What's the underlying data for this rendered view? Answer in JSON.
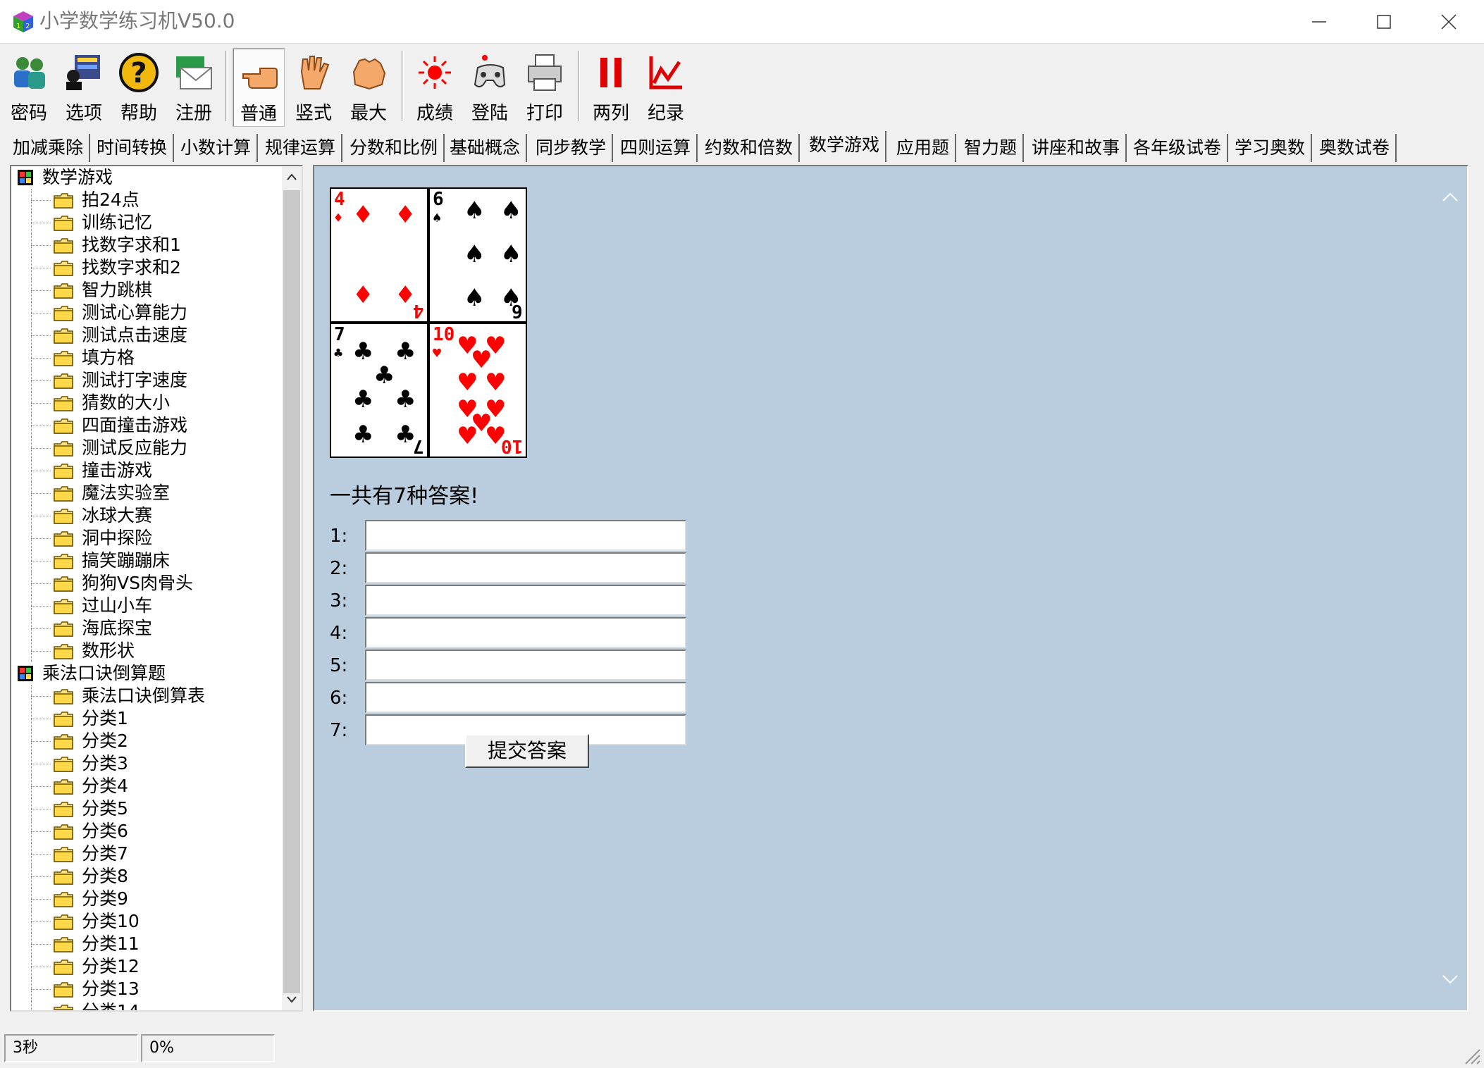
{
  "window": {
    "title": "小学数学练习机V50.0"
  },
  "toolbar": {
    "password": "密码",
    "options": "选项",
    "help": "帮助",
    "register": "注册",
    "normal": "普通",
    "vertical": "竖式",
    "maximum": "最大",
    "score": "成绩",
    "login": "登陆",
    "print": "打印",
    "two_columns": "两列",
    "record": "纪录"
  },
  "tabs": [
    "加减乘除",
    "时间转换",
    "小数计算",
    "规律运算",
    "分数和比例",
    "基础概念",
    "同步教学",
    "四则运算",
    "约数和倍数",
    "数学游戏",
    "应用题",
    "智力题",
    "讲座和故事",
    "各年级试卷",
    "学习奥数",
    "奥数试卷"
  ],
  "active_tab": "数学游戏",
  "tree": {
    "groups": [
      {
        "label": "数学游戏",
        "items": [
          "拍24点",
          "训练记忆",
          "找数字求和1",
          "找数字求和2",
          "智力跳棋",
          "测试心算能力",
          "测试点击速度",
          "填方格",
          "测试打字速度",
          "猜数的大小",
          "四面撞击游戏",
          "测试反应能力",
          "撞击游戏",
          "魔法实验室",
          "冰球大赛",
          "洞中探险",
          "搞笑蹦蹦床",
          "狗狗VS肉骨头",
          "过山小车",
          "海底探宝",
          "数形状"
        ]
      },
      {
        "label": "乘法口诀倒算题",
        "items": [
          "乘法口诀倒算表",
          "分类1",
          "分类2",
          "分类3",
          "分类4",
          "分类5",
          "分类6",
          "分类7",
          "分类8",
          "分类9",
          "分类10",
          "分类11",
          "分类12",
          "分类13",
          "分类14"
        ]
      }
    ]
  },
  "cards": [
    {
      "rank": "4",
      "suit": "diamonds",
      "symbol": "♦",
      "color": "#ff0000"
    },
    {
      "rank": "6",
      "suit": "spades",
      "symbol": "♠",
      "color": "#000000"
    },
    {
      "rank": "7",
      "suit": "clubs",
      "symbol": "♣",
      "color": "#000000"
    },
    {
      "rank": "10",
      "suit": "hearts",
      "symbol": "♥",
      "color": "#ff0000"
    }
  ],
  "answers": {
    "title": "一共有7种答案!",
    "rows": [
      {
        "label": "1:",
        "value": ""
      },
      {
        "label": "2:",
        "value": ""
      },
      {
        "label": "3:",
        "value": ""
      },
      {
        "label": "4:",
        "value": ""
      },
      {
        "label": "5:",
        "value": ""
      },
      {
        "label": "6:",
        "value": ""
      },
      {
        "label": "7:",
        "value": ""
      }
    ],
    "submit_label": "提交答案"
  },
  "status": {
    "timer": "3秒",
    "progress": "0%"
  },
  "colors": {
    "panel_bg": "#b9cdde",
    "red_suit": "#ff0000",
    "black_suit": "#000000"
  }
}
